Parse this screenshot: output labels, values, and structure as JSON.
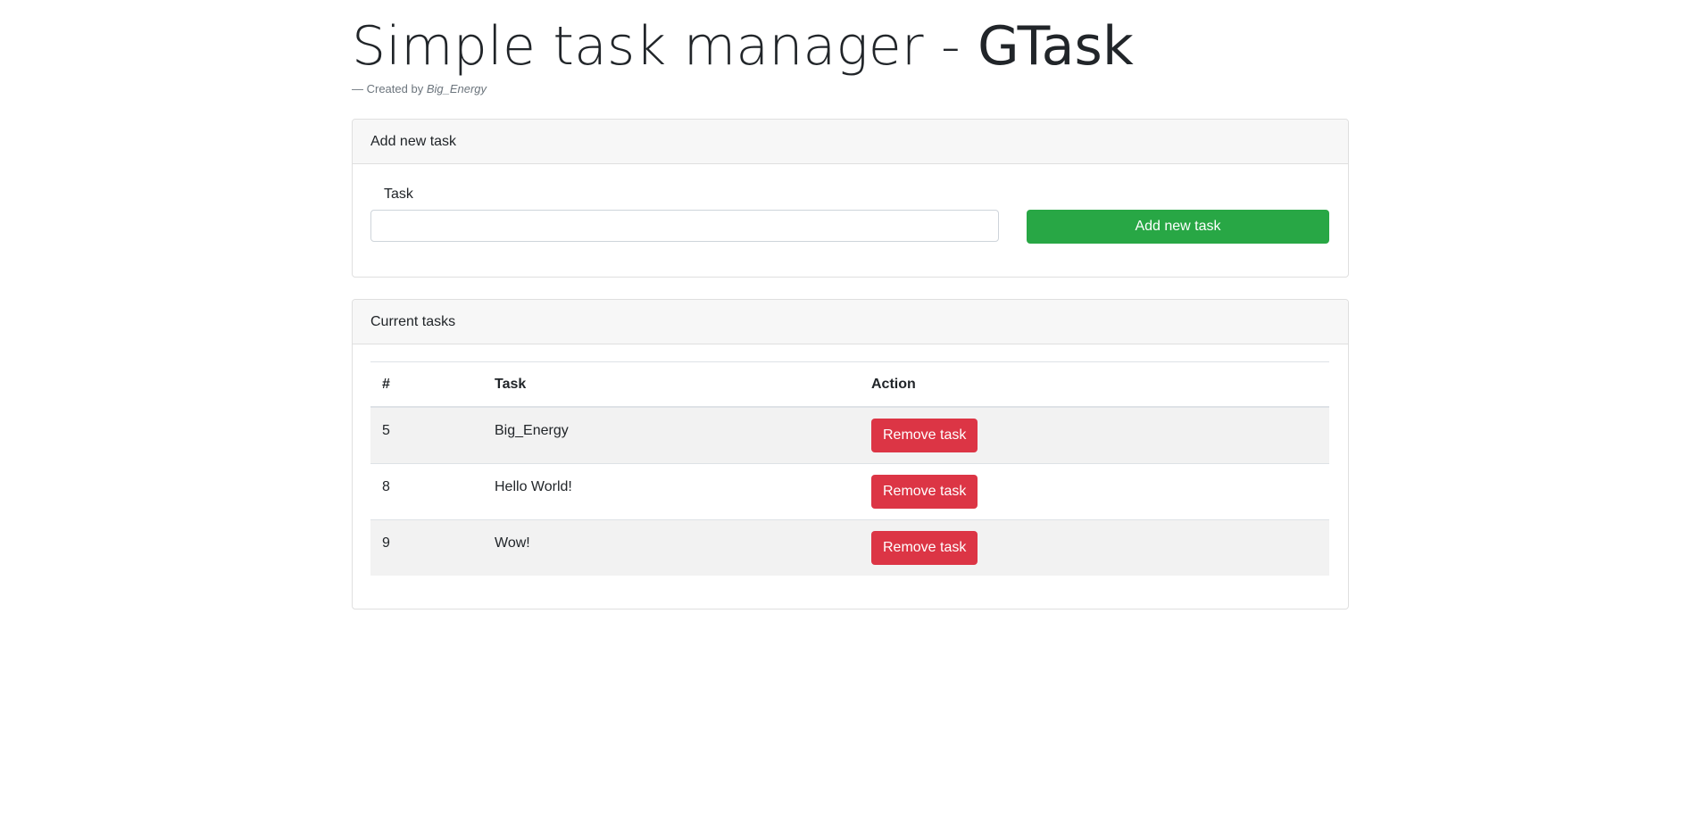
{
  "header": {
    "title_prefix": "Simple task manager - ",
    "title_brand": "GTask",
    "byline_prefix": "— Created by ",
    "byline_author": "Big_Energy"
  },
  "add_card": {
    "header": "Add new task",
    "task_label": "Task",
    "task_value": "",
    "button_label": "Add new task"
  },
  "tasks_card": {
    "header": "Current tasks",
    "columns": [
      "#",
      "Task",
      "Action"
    ],
    "rows": [
      {
        "id": "5",
        "task": "Big_Energy",
        "action": "Remove task"
      },
      {
        "id": "8",
        "task": "Hello World!",
        "action": "Remove task"
      },
      {
        "id": "9",
        "task": "Wow!",
        "action": "Remove task"
      }
    ]
  },
  "colors": {
    "success": "#28a745",
    "danger": "#dc3545",
    "stripe": "#f2f2f2"
  }
}
